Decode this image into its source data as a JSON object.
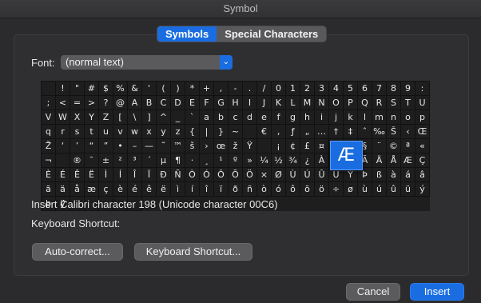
{
  "window": {
    "title": "Symbol"
  },
  "tabs": [
    {
      "label": "Symbols",
      "active": true
    },
    {
      "label": "Special Characters",
      "active": false
    }
  ],
  "font": {
    "label": "Font:",
    "value": "(normal text)"
  },
  "grid": {
    "rows": [
      [
        "",
        "!",
        "\"",
        "#",
        "$",
        "%",
        "&",
        "'",
        "(",
        ")",
        "*",
        "+",
        ",",
        "-",
        ".",
        "/",
        "0",
        "1",
        "2",
        "3",
        "4",
        "5",
        "6",
        "7",
        "8",
        "9",
        ":",
        ";"
      ],
      [
        "<",
        "=",
        ">",
        "?",
        "@",
        "A",
        "B",
        "C",
        "D",
        "E",
        "F",
        "G",
        "H",
        "I",
        "J",
        "K",
        "L",
        "M",
        "N",
        "O",
        "P",
        "Q",
        "R",
        "S",
        "T",
        "U",
        "V",
        "W"
      ],
      [
        "X",
        "Y",
        "Z",
        "[",
        "\\",
        "]",
        "^",
        "_",
        "`",
        "a",
        "b",
        "c",
        "d",
        "e",
        "f",
        "g",
        "h",
        "i",
        "j",
        "k",
        "l",
        "m",
        "n",
        "o",
        "p",
        "q",
        "r",
        "s"
      ],
      [
        "t",
        "u",
        "v",
        "w",
        "x",
        "y",
        "z",
        "{",
        "|",
        "}",
        "~",
        "",
        "€",
        "‚",
        "ƒ",
        "„",
        "…",
        "†",
        "‡",
        "ˆ",
        "‰",
        "Š",
        "‹",
        "Œ",
        "Ž",
        "‘",
        "’"
      ],
      [
        "“",
        "”",
        "•",
        "–",
        "—",
        "˜",
        "™",
        "š",
        "›",
        "œ",
        "ž",
        "Ÿ",
        "",
        "¡",
        "¢",
        "£",
        "¤",
        "¥",
        "¦",
        "§",
        "¨",
        "©",
        "ª",
        "«",
        "¬",
        "",
        "®",
        "¯"
      ],
      [
        "±",
        "²",
        "³",
        "´",
        "µ",
        "¶",
        "·",
        "¸",
        "¹",
        "º",
        "»",
        "¼",
        "½",
        "¾",
        "¿",
        "À",
        "Á",
        "Â",
        "Ã",
        "Ä",
        "Å",
        "Æ",
        "Ç",
        "È",
        "É",
        "Ê",
        "Ë",
        "Ì"
      ],
      [
        "Í",
        "Î",
        "Ï",
        "Ð",
        "Ñ",
        "Ò",
        "Ó",
        "Ô",
        "Õ",
        "Ö",
        "×",
        "Ø",
        "Ù",
        "Ú",
        "Û",
        "Ü",
        "Ý",
        "Þ",
        "ß",
        "à",
        "á",
        "â",
        "ã",
        "ä",
        "å",
        "æ",
        "ç",
        "è"
      ],
      [
        "é",
        "ê",
        "ë",
        "ì",
        "í",
        "î",
        "ï",
        "ð",
        "ñ",
        "ò",
        "ó",
        "ô",
        "õ",
        "ö",
        "÷",
        "ø",
        "ù",
        "ú",
        "û",
        "ü",
        "ý",
        "þ",
        "ÿ",
        "",
        "",
        "",
        "",
        ""
      ]
    ],
    "selected": "Æ"
  },
  "insert_info": "Insert Calibri character 198 (Unicode character 00C6)",
  "keyboard_shortcut_label": "Keyboard Shortcut:",
  "buttons": {
    "autocorrect": "Auto-correct...",
    "keyboard_shortcut": "Keyboard Shortcut...",
    "cancel": "Cancel",
    "insert": "Insert"
  }
}
